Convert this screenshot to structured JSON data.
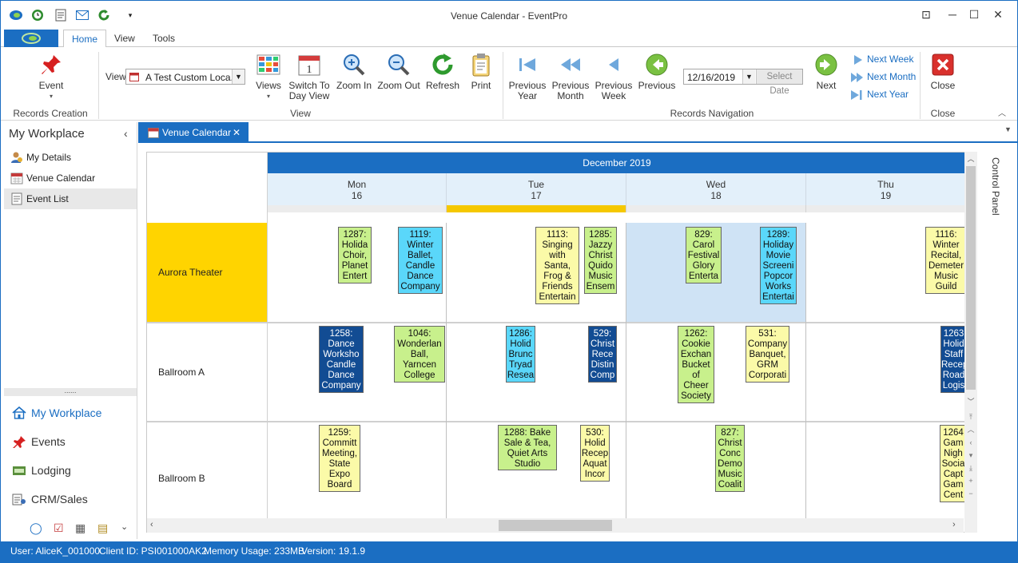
{
  "window": {
    "title": "Venue Calendar - EventPro"
  },
  "ribbon_tabs": [
    "Home",
    "View",
    "Tools"
  ],
  "ribbon": {
    "event_label": "Event",
    "records_creation_label": "Records Creation",
    "view_label": "View",
    "view_select_value": "A Test Custom Loca...",
    "views_label": "Views",
    "switch_to_day_view_line1": "Switch To",
    "switch_to_day_view_line2": "Day View",
    "zoom_in_label": "Zoom In",
    "zoom_out_label": "Zoom Out",
    "refresh_label": "Refresh",
    "print_label": "Print",
    "view_group_label": "View",
    "previous_year_line1": "Previous",
    "previous_year_line2": "Year",
    "previous_month_line1": "Previous",
    "previous_month_line2": "Month",
    "previous_week_line1": "Previous",
    "previous_week_line2": "Week",
    "previous_label": "Previous",
    "date_value": "12/16/2019",
    "select_date_label": "Select Date",
    "next_label": "Next",
    "next_week_label": "Next Week",
    "next_month_label": "Next Month",
    "next_year_label": "Next Year",
    "records_navigation_label": "Records Navigation",
    "close_label": "Close",
    "close_group_label": "Close"
  },
  "leftnav": {
    "title": "My Workplace",
    "items": [
      {
        "label": "My Details",
        "icon": "user-icon"
      },
      {
        "label": "Venue Calendar",
        "icon": "calendar-icon"
      },
      {
        "label": "Event List",
        "icon": "list-icon"
      }
    ],
    "splitter_dots": "......",
    "modules": [
      {
        "label": "My Workplace",
        "icon": "home-icon"
      },
      {
        "label": "Events",
        "icon": "pin-icon"
      },
      {
        "label": "Lodging",
        "icon": "bed-icon"
      },
      {
        "label": "CRM/Sales",
        "icon": "crm-icon"
      }
    ]
  },
  "doc_tab": {
    "label": "Venue Calendar"
  },
  "calendar": {
    "month": "December 2019",
    "days": [
      {
        "name": "Mon",
        "num": "16"
      },
      {
        "name": "Tue",
        "num": "17"
      },
      {
        "name": "Wed",
        "num": "18"
      },
      {
        "name": "Thu",
        "num": "19"
      }
    ],
    "resources": [
      "Aurora Theater",
      "Ballroom A",
      "Ballroom B"
    ],
    "events": {
      "aurora": [
        {
          "text": "1287: Holida Choir, Planet Entert",
          "color": "green"
        },
        {
          "text": "1119: Winter Ballet, Candle Dance Company",
          "color": "cyan"
        },
        {
          "text": "1113: Singing with Santa, Frog & Friends Entertain",
          "color": "yellow"
        },
        {
          "text": "1285: Jazzy Christ Quido Music Ensem",
          "color": "green"
        },
        {
          "text": "829: Carol Festival Glory Enterta",
          "color": "green"
        },
        {
          "text": "1289: Holiday Movie Screeni Popcor Works Entertai",
          "color": "cyan"
        },
        {
          "text": "1116: Winter Recital, Demeter Music Guild",
          "color": "yellow"
        }
      ],
      "ballroom_a": [
        {
          "text": "1258: Dance Worksho Candle Dance Company",
          "color": "navy"
        },
        {
          "text": "1046: Wonderlan Ball, Yarncen College",
          "color": "green"
        },
        {
          "text": "1286: Holid Brunc Tryad Resea",
          "color": "cyan"
        },
        {
          "text": "529: Christ Rece Distin Comp",
          "color": "navy"
        },
        {
          "text": "1262: Cookie Exchan Bucket of Cheer Society",
          "color": "green"
        },
        {
          "text": "531: Company Banquet, GRM Corporati",
          "color": "yellow"
        },
        {
          "text": "1263 Holid Staff Recep Road Logis",
          "color": "navy"
        }
      ],
      "ballroom_b": [
        {
          "text": "1259: Committ Meeting, State Expo Board",
          "color": "yellow"
        },
        {
          "text": "1288: Bake Sale & Tea, Quiet Arts Studio",
          "color": "green"
        },
        {
          "text": "530: Holid Recep Aquat Incor",
          "color": "yellow"
        },
        {
          "text": "827: Christ Conc Demo Music Coalit",
          "color": "green"
        },
        {
          "text": "1264 Gam Nigh Socia Capt Gam Cent",
          "color": "yellow"
        }
      ]
    }
  },
  "control_panel_label": "Control Panel",
  "status": {
    "user": "User: AliceK_001000",
    "client": "Client ID: PSI001000AK2",
    "memory": "Memory Usage: 233MB",
    "version": "Version: 19.1.9"
  }
}
